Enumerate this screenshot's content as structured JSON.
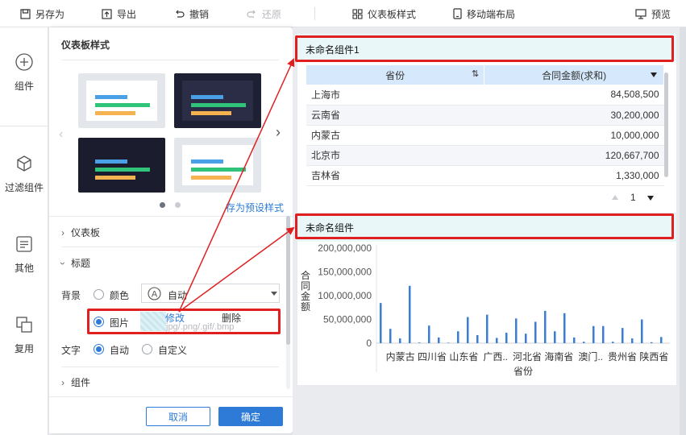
{
  "toolbar": {
    "save_as": "另存为",
    "export": "导出",
    "undo": "撤销",
    "redo": "还原",
    "dashboard_style": "仪表板样式",
    "mobile_layout": "移动端布局",
    "preview": "预览"
  },
  "leftnav": {
    "component": "组件",
    "filter_component": "过滤组件",
    "other": "其他",
    "reuse": "复用"
  },
  "panel": {
    "title": "仪表板样式",
    "save_preset": "存为预设样式",
    "sections": {
      "dashboard": "仪表板",
      "title": "标题",
      "component": "组件"
    },
    "background": {
      "label": "背景",
      "color_option": "颜色",
      "auto_value": "自动",
      "image_option": "图片",
      "modify": "修改",
      "delete": "删除",
      "hint": "jpg/.png/.gif/.bmp"
    },
    "text": {
      "label": "文字",
      "auto_option": "自动",
      "custom_option": "自定义"
    },
    "cancel": "取消",
    "confirm": "确定"
  },
  "widget1": {
    "title": "未命名组件1",
    "columns": [
      "省份",
      "合同金额(求和)"
    ],
    "rows": [
      {
        "province": "上海市",
        "amount": "84,508,500"
      },
      {
        "province": "云南省",
        "amount": "30,200,000"
      },
      {
        "province": "内蒙古",
        "amount": "10,000,000"
      },
      {
        "province": "北京市",
        "amount": "120,667,700"
      },
      {
        "province": "吉林省",
        "amount": "1,330,000"
      }
    ],
    "page": "1"
  },
  "widget2": {
    "title": "未命名组件"
  },
  "chart_data": {
    "type": "bar",
    "ylabel": "合同金额",
    "xlabel": "省份",
    "ylim": [
      0,
      200000000
    ],
    "yticks": [
      "200,000,000",
      "150,000,000",
      "100,000,000",
      "50,000,000",
      "0"
    ],
    "xtick_labels": [
      "内蒙古",
      "四川省",
      "山东省",
      "广西..",
      "河北省",
      "海南省",
      "澳门..",
      "贵州省",
      "陕西省"
    ],
    "values": [
      84508500,
      30200000,
      10000000,
      120667700,
      1330000,
      37000000,
      12000000,
      1000000,
      25000000,
      55000000,
      17000000,
      60000000,
      11000000,
      22000000,
      52000000,
      20000000,
      45000000,
      68000000,
      25000000,
      63000000,
      12000000,
      3000000,
      36000000,
      36000000,
      3000000,
      32000000,
      10000000,
      50000000,
      2000000,
      13000000
    ],
    "bar_color": "#3a7fd5",
    "grid": false
  },
  "colors": {
    "accent": "#2d7bd6",
    "highlight_red": "#e02020",
    "table_header": "#d6e8fb",
    "title_bg": "#e9f7f8"
  }
}
